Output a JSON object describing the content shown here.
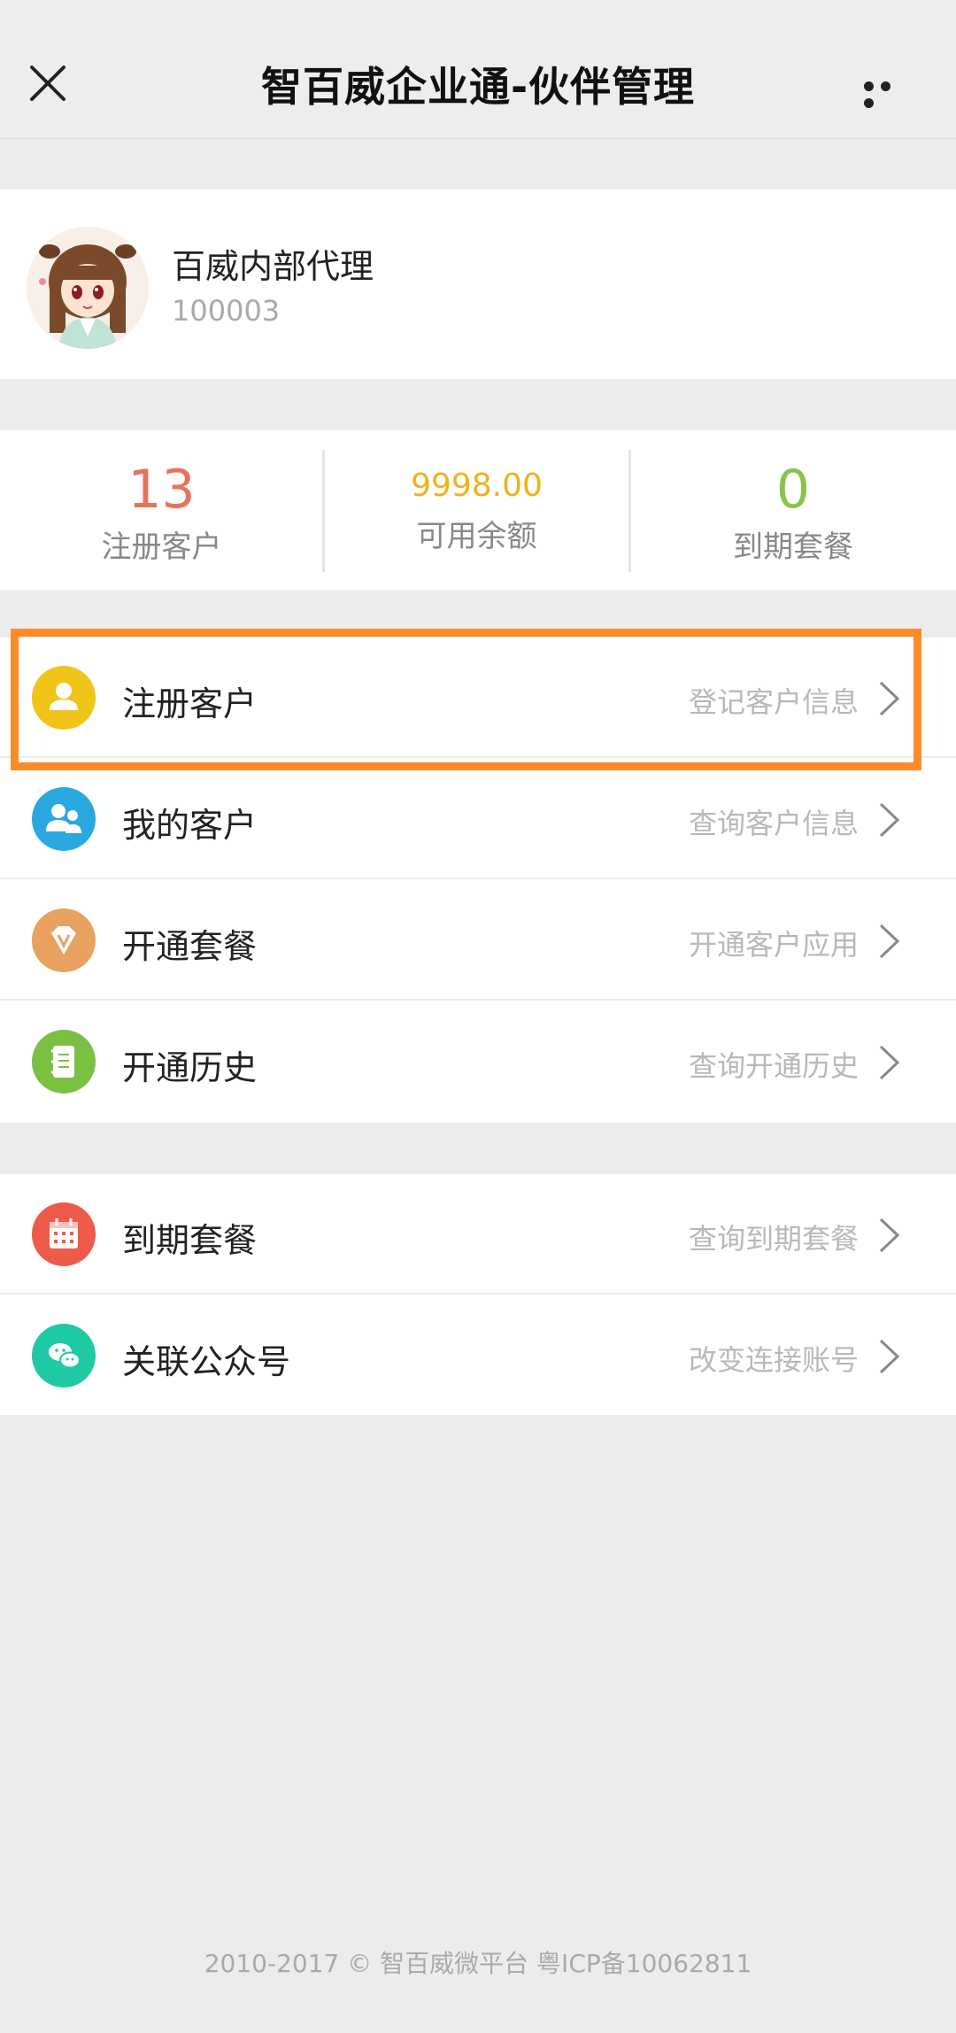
{
  "header": {
    "title": "智百威企业通-伙伴管理"
  },
  "profile": {
    "name": "百威内部代理",
    "id": "100003"
  },
  "stats": [
    {
      "value": "13",
      "label": "注册客户",
      "color": "#e8735a"
    },
    {
      "value": "9998.00",
      "label": "可用余额",
      "color": "#f1b11d"
    },
    {
      "value": "0",
      "label": "到期套餐",
      "color": "#8bc34a"
    }
  ],
  "menu_group1": [
    {
      "label": "注册客户",
      "hint": "登记客户信息",
      "icon": "user-icon",
      "color": "#f0c419"
    },
    {
      "label": "我的客户",
      "hint": "查询客户信息",
      "icon": "users-icon",
      "color": "#29a8e0"
    },
    {
      "label": "开通套餐",
      "hint": "开通客户应用",
      "icon": "diamond-icon",
      "color": "#e9a15f"
    },
    {
      "label": "开通历史",
      "hint": "查询开通历史",
      "icon": "notebook-icon",
      "color": "#7ac142"
    }
  ],
  "menu_group2": [
    {
      "label": "到期套餐",
      "hint": "查询到期套餐",
      "icon": "calendar-icon",
      "color": "#ee5b4a"
    },
    {
      "label": "关联公众号",
      "hint": "改变连接账号",
      "icon": "wechat-icon",
      "color": "#1fc9a4"
    }
  ],
  "highlight_color": "#ff8a2a",
  "footer": {
    "text": "2010-2017 © 智百威微平台 粤ICP备10062811"
  }
}
